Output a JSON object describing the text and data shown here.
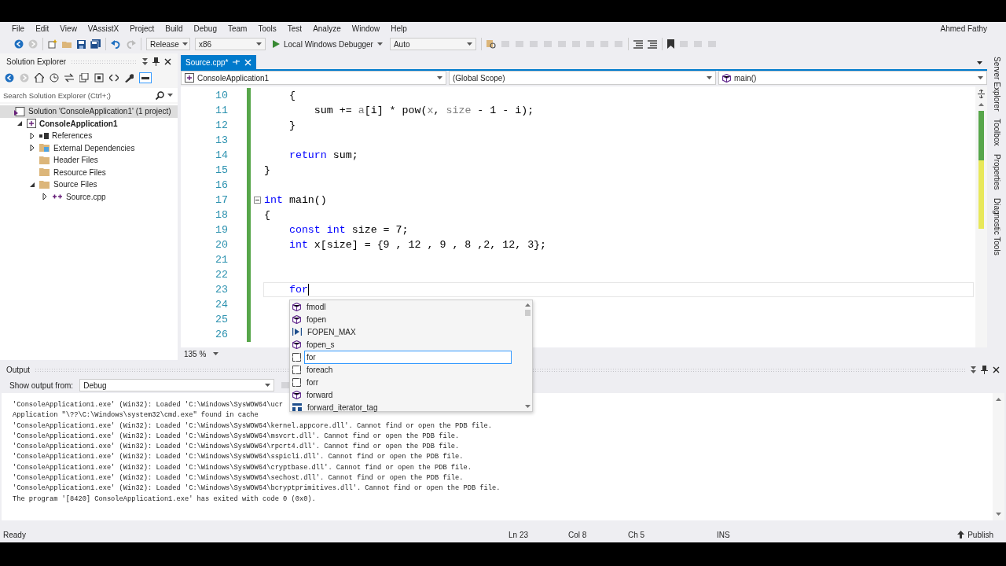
{
  "menu": [
    "File",
    "Edit",
    "View",
    "VAssistX",
    "Project",
    "Build",
    "Debug",
    "Team",
    "Tools",
    "Test",
    "Analyze",
    "Window",
    "Help"
  ],
  "user": "Ahmed Fathy",
  "toolbar": {
    "configuration": "Release",
    "platform": "x86",
    "debugger": "Local Windows Debugger",
    "solution_config": "Auto"
  },
  "solution_explorer": {
    "title": "Solution Explorer",
    "search": {
      "placeholder": "Search Solution Explorer (Ctrl+;)"
    },
    "tree": [
      {
        "label": "Solution 'ConsoleApplication1' (1 project)",
        "kind": "solution",
        "selected": true,
        "children": [
          {
            "label": "ConsoleApplication1",
            "kind": "project",
            "selected": false,
            "expanded": true,
            "children": [
              {
                "label": "References",
                "kind": "references",
                "selected": false,
                "expanded": false
              },
              {
                "label": "External Dependencies",
                "kind": "external",
                "selected": false,
                "expanded": false
              },
              {
                "label": "Header Files",
                "kind": "folder",
                "selected": false
              },
              {
                "label": "Resource Files",
                "kind": "folder",
                "selected": false
              },
              {
                "label": "Source Files",
                "kind": "folder",
                "selected": false,
                "expanded": true,
                "children": [
                  {
                    "label": "Source.cpp",
                    "kind": "file",
                    "selected": false,
                    "expanded": false
                  }
                ]
              }
            ]
          }
        ]
      }
    ]
  },
  "editor": {
    "tabs": [
      {
        "label": "Source.cpp*",
        "selected": true
      }
    ],
    "nav": [
      {
        "label": "ConsoleApplication1",
        "kind": "project"
      },
      {
        "label": "(Global Scope)",
        "kind": "scope"
      },
      {
        "label": "main()",
        "kind": "function"
      }
    ],
    "lines": [
      {
        "number": "10",
        "modified": true,
        "fold": false,
        "current": false,
        "tokens": [
          {
            "text": "    {",
            "kind": "plain"
          }
        ]
      },
      {
        "number": "11",
        "modified": true,
        "fold": false,
        "current": false,
        "tokens": [
          {
            "text": "        sum += ",
            "kind": "plain"
          },
          {
            "text": "a",
            "kind": "param"
          },
          {
            "text": "[i] * pow(",
            "kind": "plain"
          },
          {
            "text": "x",
            "kind": "param"
          },
          {
            "text": ", ",
            "kind": "plain"
          },
          {
            "text": "size",
            "kind": "param"
          },
          {
            "text": " - 1 - i);",
            "kind": "plain"
          }
        ]
      },
      {
        "number": "12",
        "modified": true,
        "fold": false,
        "current": false,
        "tokens": [
          {
            "text": "    }",
            "kind": "plain"
          }
        ]
      },
      {
        "number": "13",
        "modified": true,
        "fold": false,
        "current": false
      },
      {
        "number": "14",
        "modified": true,
        "fold": false,
        "current": false,
        "tokens": [
          {
            "text": "    return",
            "kind": "keyword"
          },
          {
            "text": " sum;",
            "kind": "plain"
          }
        ]
      },
      {
        "number": "15",
        "modified": true,
        "fold": false,
        "current": false,
        "tokens": [
          {
            "text": "}",
            "kind": "plain"
          }
        ]
      },
      {
        "number": "16",
        "modified": true,
        "fold": false,
        "current": false
      },
      {
        "number": "17",
        "modified": true,
        "fold": true,
        "current": false,
        "tokens": [
          {
            "text": "int",
            "kind": "keyword"
          },
          {
            "text": " main()",
            "kind": "plain"
          }
        ]
      },
      {
        "number": "18",
        "modified": true,
        "fold": false,
        "current": false,
        "tokens": [
          {
            "text": "{",
            "kind": "plain"
          }
        ]
      },
      {
        "number": "19",
        "modified": true,
        "fold": false,
        "current": false,
        "tokens": [
          {
            "text": "    const int",
            "kind": "keyword"
          },
          {
            "text": " size = 7;",
            "kind": "plain"
          }
        ]
      },
      {
        "number": "20",
        "modified": true,
        "fold": false,
        "current": false,
        "tokens": [
          {
            "text": "    int",
            "kind": "keyword"
          },
          {
            "text": " x[size] = {9 , 12 , 9 , 8 ,2, 12, 3};",
            "kind": "plain"
          }
        ]
      },
      {
        "number": "21",
        "modified": true,
        "fold": false,
        "current": false
      },
      {
        "number": "22",
        "modified": true,
        "fold": false,
        "current": false
      },
      {
        "number": "23",
        "modified": true,
        "fold": false,
        "current": true,
        "tokens": [
          {
            "text": "    for",
            "kind": "keyword"
          }
        ]
      },
      {
        "number": "24",
        "modified": true,
        "fold": false,
        "current": false
      },
      {
        "number": "25",
        "modified": true,
        "fold": false,
        "current": false
      },
      {
        "number": "26",
        "modified": true,
        "fold": false,
        "current": false
      }
    ],
    "zoom": "135 %",
    "completion": [
      {
        "label": "fmodl",
        "kind": "function",
        "selected": false
      },
      {
        "label": "fopen",
        "kind": "function",
        "selected": false
      },
      {
        "label": "FOPEN_MAX",
        "kind": "macro",
        "selected": false
      },
      {
        "label": "fopen_s",
        "kind": "function",
        "selected": false
      },
      {
        "label": "for",
        "kind": "snippet",
        "selected": true
      },
      {
        "label": "foreach",
        "kind": "snippet",
        "selected": false
      },
      {
        "label": "forr",
        "kind": "snippet",
        "selected": false
      },
      {
        "label": "forward",
        "kind": "function",
        "selected": false
      },
      {
        "label": "forward_iterator_tag",
        "kind": "type",
        "selected": false
      }
    ]
  },
  "side_tabs": [
    "Server Explorer",
    "Toolbox",
    "Properties",
    "Diagnostic Tools"
  ],
  "output": {
    "title": "Output",
    "source_label": "Show output from:",
    "source": "Debug",
    "lines": [
      "'ConsoleApplication1.exe' (Win32): Loaded 'C:\\Windows\\SysWOW64\\ucr",
      "Application \"\\??\\C:\\Windows\\system32\\cmd.exe\" found in cache",
      "'ConsoleApplication1.exe' (Win32): Loaded 'C:\\Windows\\SysWOW64\\kernel.appcore.dll'. Cannot find or open the PDB file.",
      "'ConsoleApplication1.exe' (Win32): Loaded 'C:\\Windows\\SysWOW64\\msvcrt.dll'. Cannot find or open the PDB file.",
      "'ConsoleApplication1.exe' (Win32): Loaded 'C:\\Windows\\SysWOW64\\rpcrt4.dll'. Cannot find or open the PDB file.",
      "'ConsoleApplication1.exe' (Win32): Loaded 'C:\\Windows\\SysWOW64\\sspicli.dll'. Cannot find or open the PDB file.",
      "'ConsoleApplication1.exe' (Win32): Loaded 'C:\\Windows\\SysWOW64\\cryptbase.dll'. Cannot find or open the PDB file.",
      "'ConsoleApplication1.exe' (Win32): Loaded 'C:\\Windows\\SysWOW64\\sechost.dll'. Cannot find or open the PDB file.",
      "'ConsoleApplication1.exe' (Win32): Loaded 'C:\\Windows\\SysWOW64\\bcryptprimitives.dll'. Cannot find or open the PDB file.",
      "The program '[8420] ConsoleApplication1.exe' has exited with code 0 (0x0)."
    ]
  },
  "status_bar": {
    "message": "Ready",
    "line": "Ln 23",
    "col": "Col 8",
    "ch": "Ch 5",
    "mode": "INS",
    "publish": "Publish"
  }
}
